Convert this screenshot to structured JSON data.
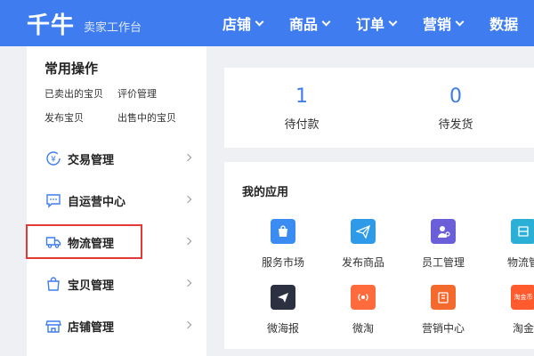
{
  "header": {
    "logo": "千牛",
    "subtitle": "卖家工作台",
    "nav": [
      {
        "label": "店铺"
      },
      {
        "label": "商品"
      },
      {
        "label": "订单"
      },
      {
        "label": "营销"
      },
      {
        "label": "数据"
      }
    ],
    "bg_color": "#3e7cf0"
  },
  "sidebar": {
    "quick_title": "常用操作",
    "quick_links": [
      "已卖出的宝贝",
      "评价管理",
      "发布宝贝",
      "出售中的宝贝"
    ],
    "menu": [
      {
        "label": "交易管理",
        "icon": "yen-circle-icon"
      },
      {
        "label": "自运营中心",
        "icon": "chat-bubble-icon"
      },
      {
        "label": "物流管理",
        "icon": "truck-icon",
        "highlighted": true
      },
      {
        "label": "宝贝管理",
        "icon": "shopping-bag-icon"
      },
      {
        "label": "店铺管理",
        "icon": "store-icon"
      }
    ]
  },
  "stats": [
    {
      "value": "1",
      "label": "待付款"
    },
    {
      "value": "0",
      "label": "待发货"
    }
  ],
  "apps": {
    "title": "我的应用",
    "items": [
      {
        "label": "服务市场",
        "icon": "service-market-icon",
        "color": "#3b8cf2"
      },
      {
        "label": "发布商品",
        "icon": "paper-plane-icon",
        "color": "#2f9be8"
      },
      {
        "label": "员工管理",
        "icon": "employee-icon",
        "color": "#6a5fd8"
      },
      {
        "label": "物流管",
        "icon": "logistics-icon",
        "color": "#2ab0d6"
      },
      {
        "label": "微海报",
        "icon": "poster-icon",
        "color": "#2c3142"
      },
      {
        "label": "微淘",
        "icon": "weitao-icon",
        "color": "#ff6b3d"
      },
      {
        "label": "营销中心",
        "icon": "marketing-icon",
        "color": "#f46a2c"
      },
      {
        "label": "淘金",
        "icon": "taojin-icon",
        "color": "#ff5b2e",
        "icon_text": "淘金币"
      }
    ]
  },
  "accent_color": "#3e7cf0",
  "highlight_color": "#e53935"
}
